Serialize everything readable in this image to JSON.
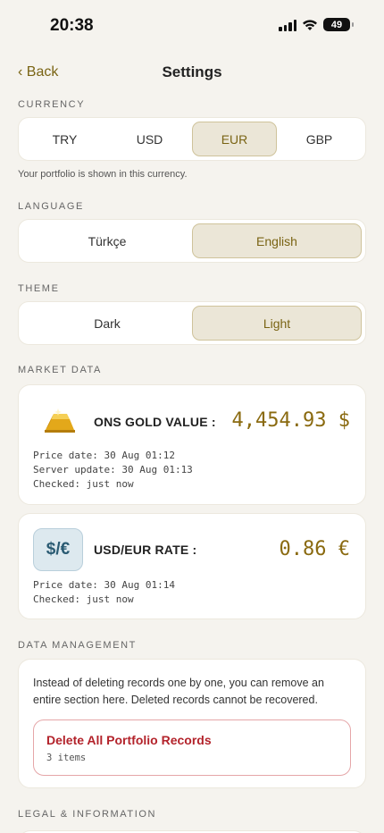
{
  "status": {
    "time": "20:38",
    "battery": "49"
  },
  "nav": {
    "back": "‹ Back",
    "title": "Settings"
  },
  "currency": {
    "label": "CURRENCY",
    "options": [
      "TRY",
      "USD",
      "EUR",
      "GBP"
    ],
    "selected": "EUR",
    "hint": "Your portfolio is shown in this currency."
  },
  "language": {
    "label": "LANGUAGE",
    "options": [
      "Türkçe",
      "English"
    ],
    "selected": "English"
  },
  "theme": {
    "label": "THEME",
    "options": [
      "Dark",
      "Light"
    ],
    "selected": "Light"
  },
  "market": {
    "label": "MARKET DATA",
    "gold": {
      "label": "ONS GOLD VALUE :",
      "value": "4,454.93 $",
      "price_date": "Price date: 30 Aug 01:12",
      "server_update": "Server update: 30 Aug 01:13",
      "checked": "Checked: just now"
    },
    "rate": {
      "icon_text": "$/€",
      "label": "USD/EUR RATE :",
      "value": "0.86 €",
      "price_date": "Price date: 30 Aug 01:14",
      "checked": "Checked: just now"
    }
  },
  "data_management": {
    "label": "DATA MANAGEMENT",
    "description": "Instead of deleting records one by one, you can remove an entire section here. Deleted records cannot be recovered.",
    "delete_title": "Delete All Portfolio Records",
    "delete_count": "3 items"
  },
  "legal": {
    "label": "LEGAL & INFORMATION"
  },
  "colors": {
    "accent": "#7a6414",
    "danger": "#b3232b",
    "background": "#f5f3ee"
  }
}
